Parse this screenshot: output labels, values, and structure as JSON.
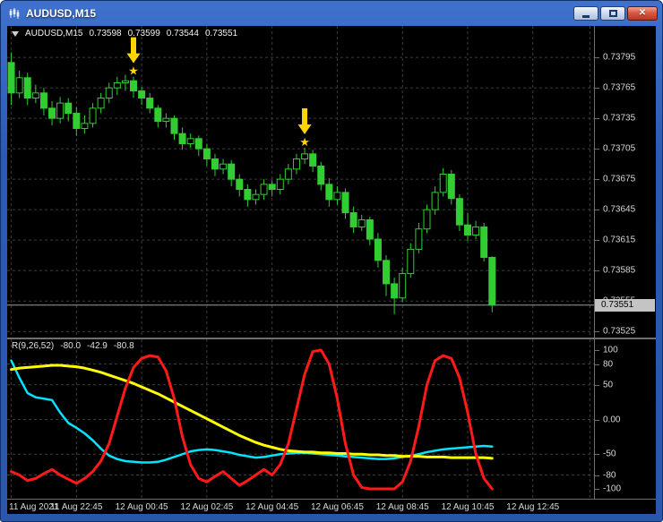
{
  "window": {
    "title": "AUDUSD,M15"
  },
  "quote": {
    "symbol": "AUDUSD,M15",
    "open": "0.73598",
    "high": "0.73599",
    "low": "0.73544",
    "close": "0.73551",
    "bid_tag": "0.73551"
  },
  "indicator": {
    "name": "R(9,26,52)",
    "values": [
      "-80.0",
      "-42.9",
      "-80.8"
    ]
  },
  "chart_data": [
    {
      "type": "candlestick",
      "title": "AUDUSD M15 candlestick chart",
      "symbol": "AUDUSD",
      "timeframe": "M15",
      "price_axis": {
        "view_max": 0.73826,
        "view_min": 0.73519,
        "ticks": [
          {
            "v": 0.73795,
            "label": "0.73795"
          },
          {
            "v": 0.73765,
            "label": "0.73765"
          },
          {
            "v": 0.73735,
            "label": "0.73735"
          },
          {
            "v": 0.73705,
            "label": "0.73705"
          },
          {
            "v": 0.73675,
            "label": "0.73675"
          },
          {
            "v": 0.73645,
            "label": "0.73645"
          },
          {
            "v": 0.73615,
            "label": "0.73615"
          },
          {
            "v": 0.73585,
            "label": "0.73585"
          },
          {
            "v": 0.73555,
            "label": "0.73555"
          },
          {
            "v": 0.73525,
            "label": "0.73525"
          }
        ]
      },
      "time_axis": {
        "slots": 72,
        "labels": [
          {
            "index": 0,
            "text": "11 Aug 2021"
          },
          {
            "index": 8,
            "text": "11 Aug 22:45"
          },
          {
            "index": 16,
            "text": "12 Aug 00:45"
          },
          {
            "index": 24,
            "text": "12 Aug 02:45"
          },
          {
            "index": 32,
            "text": "12 Aug 04:45"
          },
          {
            "index": 40,
            "text": "12 Aug 06:45"
          },
          {
            "index": 48,
            "text": "12 Aug 08:45"
          },
          {
            "index": 56,
            "text": "12 Aug 10:45"
          },
          {
            "index": 64,
            "text": "12 Aug 12:45"
          }
        ],
        "grid_indices": [
          0,
          8,
          16,
          24,
          32,
          40,
          48,
          56,
          64,
          71
        ]
      },
      "current_price": 0.73551,
      "signals": [
        {
          "index": 15,
          "kind": "sell-arrow-with-star"
        },
        {
          "index": 36,
          "kind": "sell-arrow-with-star"
        }
      ],
      "colors": {
        "candle": "#32CD32",
        "grid": "#3c3c3c",
        "bid_line": "#9aa0a0",
        "signal": "#FFD400"
      },
      "candles": [
        [
          0.7379,
          0.738,
          0.73748,
          0.7376
        ],
        [
          0.7376,
          0.73782,
          0.73755,
          0.73775
        ],
        [
          0.73775,
          0.7378,
          0.73748,
          0.73755
        ],
        [
          0.73755,
          0.73768,
          0.7375,
          0.7376
        ],
        [
          0.7376,
          0.73765,
          0.73738,
          0.73745
        ],
        [
          0.73745,
          0.73752,
          0.73728,
          0.73735
        ],
        [
          0.73735,
          0.73756,
          0.7373,
          0.7375
        ],
        [
          0.7375,
          0.73755,
          0.73732,
          0.7374
        ],
        [
          0.7374,
          0.73746,
          0.73718,
          0.73725
        ],
        [
          0.73725,
          0.73738,
          0.7372,
          0.7373
        ],
        [
          0.7373,
          0.7375,
          0.73726,
          0.73745
        ],
        [
          0.73745,
          0.7376,
          0.7374,
          0.73755
        ],
        [
          0.73755,
          0.7377,
          0.7375,
          0.73765
        ],
        [
          0.73765,
          0.73776,
          0.73758,
          0.7377
        ],
        [
          0.7377,
          0.73778,
          0.73762,
          0.73772
        ],
        [
          0.73772,
          0.73776,
          0.73755,
          0.73762
        ],
        [
          0.73762,
          0.73766,
          0.73748,
          0.73755
        ],
        [
          0.73755,
          0.7376,
          0.7374,
          0.73745
        ],
        [
          0.73745,
          0.73748,
          0.73726,
          0.73732
        ],
        [
          0.73732,
          0.7374,
          0.73726,
          0.73735
        ],
        [
          0.73735,
          0.73738,
          0.73714,
          0.7372
        ],
        [
          0.7372,
          0.73726,
          0.73704,
          0.7371
        ],
        [
          0.7371,
          0.7372,
          0.73706,
          0.73715
        ],
        [
          0.73715,
          0.73718,
          0.73698,
          0.73705
        ],
        [
          0.73705,
          0.7371,
          0.73688,
          0.73695
        ],
        [
          0.73695,
          0.737,
          0.73678,
          0.73685
        ],
        [
          0.73685,
          0.73695,
          0.7368,
          0.7369
        ],
        [
          0.7369,
          0.73694,
          0.73668,
          0.73675
        ],
        [
          0.73675,
          0.7368,
          0.73658,
          0.73665
        ],
        [
          0.73665,
          0.7367,
          0.73648,
          0.73655
        ],
        [
          0.73655,
          0.73665,
          0.7365,
          0.7366
        ],
        [
          0.7366,
          0.73675,
          0.73655,
          0.7367
        ],
        [
          0.7367,
          0.73674,
          0.73658,
          0.73665
        ],
        [
          0.73665,
          0.7368,
          0.7366,
          0.73675
        ],
        [
          0.73675,
          0.7369,
          0.7367,
          0.73685
        ],
        [
          0.73685,
          0.737,
          0.7368,
          0.73695
        ],
        [
          0.73695,
          0.73706,
          0.7369,
          0.737
        ],
        [
          0.737,
          0.73704,
          0.73682,
          0.73688
        ],
        [
          0.73688,
          0.73692,
          0.73664,
          0.7367
        ],
        [
          0.7367,
          0.73676,
          0.73648,
          0.73655
        ],
        [
          0.73655,
          0.73668,
          0.7365,
          0.73662
        ],
        [
          0.73662,
          0.73666,
          0.73636,
          0.73642
        ],
        [
          0.73642,
          0.73648,
          0.73622,
          0.73628
        ],
        [
          0.73628,
          0.7364,
          0.73624,
          0.73635
        ],
        [
          0.73635,
          0.73638,
          0.7361,
          0.73616
        ],
        [
          0.73616,
          0.73622,
          0.73588,
          0.73595
        ],
        [
          0.73595,
          0.736,
          0.7356,
          0.73572
        ],
        [
          0.73572,
          0.73578,
          0.73542,
          0.73558
        ],
        [
          0.73558,
          0.73588,
          0.73554,
          0.73582
        ],
        [
          0.73582,
          0.73612,
          0.73578,
          0.73606
        ],
        [
          0.73606,
          0.73632,
          0.73602,
          0.73626
        ],
        [
          0.73626,
          0.7365,
          0.73622,
          0.73645
        ],
        [
          0.73645,
          0.73668,
          0.7364,
          0.73662
        ],
        [
          0.73662,
          0.73686,
          0.73658,
          0.7368
        ],
        [
          0.7368,
          0.73684,
          0.7365,
          0.73656
        ],
        [
          0.73656,
          0.7366,
          0.73624,
          0.7363
        ],
        [
          0.7363,
          0.73642,
          0.73614,
          0.7362
        ],
        [
          0.7362,
          0.73634,
          0.73616,
          0.73628
        ],
        [
          0.73628,
          0.73632,
          0.73594,
          0.73598
        ],
        [
          0.73598,
          0.73599,
          0.73544,
          0.73551
        ]
      ]
    },
    {
      "type": "line",
      "title": "R(9,26,52) oscillator",
      "current_values": [
        -80.0,
        -42.9,
        -80.8
      ],
      "y_axis": {
        "min": -100,
        "max": 100,
        "ticks": [
          {
            "v": 100,
            "label": "100"
          },
          {
            "v": 80,
            "label": "80"
          },
          {
            "v": 50,
            "label": "50"
          },
          {
            "v": 0,
            "label": "0.00"
          },
          {
            "v": -50,
            "label": "-50"
          },
          {
            "v": -80,
            "label": "-80"
          },
          {
            "v": -100,
            "label": "-100"
          }
        ],
        "level_lines": [
          80,
          50,
          0,
          -50,
          -80
        ]
      },
      "series": [
        {
          "name": "fast-line",
          "color": "#FF1A1A",
          "values": [
            -75,
            -80,
            -88,
            -85,
            -78,
            -72,
            -80,
            -86,
            -92,
            -85,
            -75,
            -60,
            -35,
            5,
            45,
            75,
            88,
            92,
            90,
            70,
            30,
            -25,
            -65,
            -85,
            -90,
            -82,
            -75,
            -85,
            -95,
            -88,
            -80,
            -72,
            -80,
            -65,
            -35,
            15,
            65,
            98,
            100,
            80,
            30,
            -35,
            -80,
            -98,
            -100,
            -100,
            -100,
            -100,
            -90,
            -60,
            -10,
            50,
            85,
            92,
            88,
            60,
            10,
            -50,
            -85,
            -100
          ]
        },
        {
          "name": "slow-line",
          "color": "#FFFF00",
          "values": [
            72,
            74,
            75,
            76,
            77,
            78,
            78,
            77,
            76,
            74,
            71,
            68,
            64,
            60,
            56,
            52,
            47,
            42,
            37,
            31,
            25,
            19,
            13,
            7,
            1,
            -5,
            -11,
            -17,
            -23,
            -28,
            -33,
            -37,
            -40,
            -43,
            -45,
            -46,
            -47,
            -47,
            -48,
            -48,
            -49,
            -49,
            -50,
            -50,
            -51,
            -51,
            -52,
            -52,
            -53,
            -53,
            -53,
            -54,
            -54,
            -54,
            -55,
            -55,
            -55,
            -55,
            -55,
            -56
          ]
        },
        {
          "name": "signal-line",
          "color": "#00E5FF",
          "values": [
            85,
            60,
            38,
            32,
            30,
            28,
            10,
            -5,
            -12,
            -20,
            -30,
            -42,
            -52,
            -57,
            -60,
            -61,
            -62,
            -62,
            -61,
            -58,
            -54,
            -50,
            -46,
            -44,
            -43,
            -44,
            -46,
            -48,
            -51,
            -53,
            -55,
            -54,
            -52,
            -50,
            -49,
            -48,
            -48,
            -49,
            -50,
            -51,
            -52,
            -53,
            -54,
            -55,
            -56,
            -57,
            -57,
            -56,
            -54,
            -52,
            -50,
            -47,
            -45,
            -43,
            -42,
            -41,
            -40,
            -39,
            -38,
            -39
          ]
        }
      ]
    }
  ]
}
